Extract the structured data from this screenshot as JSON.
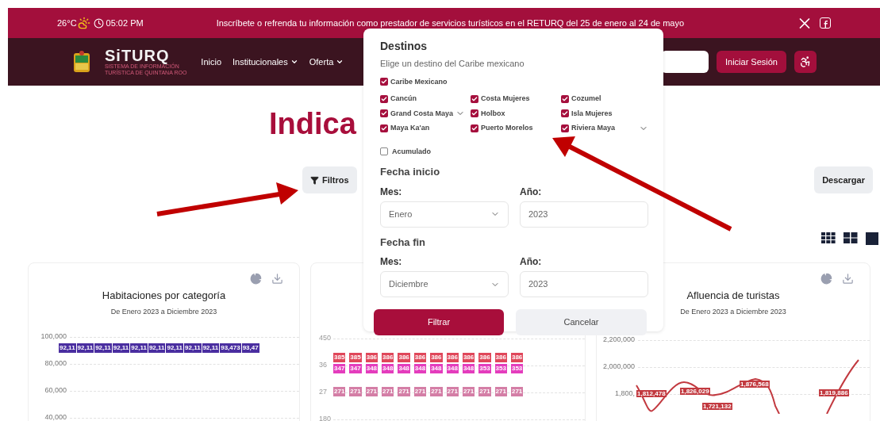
{
  "top_bar": {
    "temperature": "26°C",
    "time": "05:02 PM",
    "announcement": "Inscríbete o refrenda tu información como prestador de servicios turísticos en el RETURQ del 25 de enero al 24 de mayo"
  },
  "nav": {
    "logo_text": "SiTURQ",
    "logo_subtitle": [
      "SISTEMA DE INFORMACIÓN",
      "TURÍSTICA DE QUINTANA ROO"
    ],
    "menu": [
      {
        "label": "Inicio",
        "dropdown": false
      },
      {
        "label": "Institucionales",
        "dropdown": true
      },
      {
        "label": "Oferta",
        "dropdown": true
      }
    ],
    "login_button": "Iniciar Sesión"
  },
  "page": {
    "title": "Indica",
    "filters_button": "Filtros",
    "download_button": "Descargar"
  },
  "charts": [
    {
      "title": "Habitaciones por categoría",
      "subtitle": "De Enero 2023 a Diciembre 2023",
      "y_labels": [
        "100,000",
        "80,000",
        "60,000",
        "40,000"
      ],
      "label_rows": [
        {
          "color": "#4a2ea0",
          "labels": [
            "92,11",
            "92,11",
            "92,11",
            "92,11",
            "92,11",
            "92,11",
            "92,11",
            "92,11",
            "92,11",
            "93,473",
            "93,47"
          ]
        }
      ]
    },
    {
      "y_labels": [
        "450",
        "36",
        "27",
        "180"
      ],
      "label_rows": [
        {
          "color": "#e0475a",
          "labels": [
            "385",
            "385",
            "386",
            "386",
            "386",
            "386",
            "386",
            "386",
            "386",
            "386",
            "386",
            "386"
          ]
        },
        {
          "color": "#e43dbd",
          "labels": [
            "347",
            "347",
            "348",
            "348",
            "348",
            "348",
            "348",
            "348",
            "348",
            "353",
            "353",
            "353"
          ]
        },
        {
          "color": "#d47ea6",
          "labels": [
            "271",
            "271",
            "271",
            "271",
            "271",
            "271",
            "271",
            "271",
            "271",
            "271",
            "271",
            "271"
          ]
        }
      ]
    },
    {
      "title": "Afluencia de turistas",
      "subtitle": "De Enero 2023 a Diciembre 2023",
      "y_labels": [
        "2,200,000",
        "2,000,000",
        "1,800,"
      ],
      "label_rows": [
        {
          "color": "#c23a40",
          "labels": [
            "1,812,478",
            "1,826,029",
            "1,721,132",
            "1,876,568",
            "1,819,886"
          ]
        }
      ]
    }
  ],
  "filter_panel": {
    "title": "Destinos",
    "subtitle": "Elige un destino del Caribe mexicano",
    "all_option": {
      "label": "Caribe Mexicano",
      "checked": true
    },
    "destinations": [
      {
        "label": "Cancún",
        "checked": true,
        "expandable": false
      },
      {
        "label": "Costa Mujeres",
        "checked": true,
        "expandable": false
      },
      {
        "label": "Cozumel",
        "checked": true,
        "expandable": false
      },
      {
        "label": "Grand Costa Maya",
        "checked": true,
        "expandable": true
      },
      {
        "label": "Holbox",
        "checked": true,
        "expandable": false
      },
      {
        "label": "Isla Mujeres",
        "checked": true,
        "expandable": false
      },
      {
        "label": "Maya Ka'an",
        "checked": true,
        "expandable": false
      },
      {
        "label": "Puerto Morelos",
        "checked": true,
        "expandable": false
      },
      {
        "label": "Riviera Maya",
        "checked": true,
        "expandable": true
      }
    ],
    "cumulative": {
      "label": "Acumulado",
      "checked": false
    },
    "ranges": [
      {
        "heading": "Fecha inicio",
        "month_label": "Mes:",
        "month": "Enero",
        "year_label": "Año:",
        "year": "2023"
      },
      {
        "heading": "Fecha fin",
        "month_label": "Mes:",
        "month": "Diciembre",
        "year_label": "Año:",
        "year": "2023"
      }
    ],
    "apply_button": "Filtrar",
    "cancel_button": "Cancelar"
  }
}
